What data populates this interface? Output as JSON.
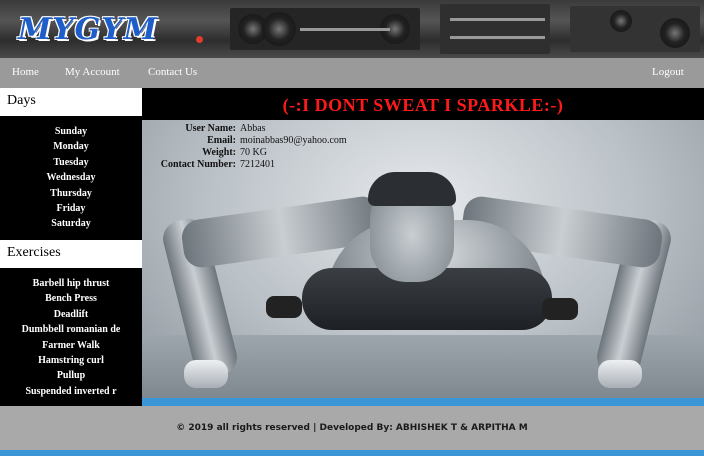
{
  "brand": {
    "logo_text": "MYGYM"
  },
  "nav": {
    "items": [
      {
        "label": "Home"
      },
      {
        "label": "My Account"
      },
      {
        "label": "Contact Us"
      }
    ],
    "logout_label": "Logout"
  },
  "sidebar": {
    "days_title": "Days",
    "days": [
      "Sunday",
      "Monday",
      "Tuesday",
      "Wednesday",
      "Thursday",
      "Friday",
      "Saturday"
    ],
    "exercises_title": "Exercises",
    "exercises": [
      "Barbell hip thrust",
      "Bench Press",
      "Deadlift",
      "Dumbbell romanian de",
      "Farmer Walk",
      "Hamstring curl",
      "Pullup",
      "Suspended inverted r"
    ]
  },
  "main": {
    "banner": "(-:I DONT SWEAT I SPARKLE:-)",
    "user": {
      "name_label": "User Name:",
      "name_value": "Abbas",
      "email_label": "Email:",
      "email_value": "moinabbas90@yahoo.com",
      "weight_label": "Weight:",
      "weight_value": "70 KG",
      "contact_label": "Contact Number:",
      "contact_value": "7212401"
    }
  },
  "footer": {
    "text": "© 2019 all rights reserved | Developed By: ABHISHEK T & ARPITHA M"
  },
  "colors": {
    "accent": "#3a96d6",
    "banner_text": "#ff1a1a",
    "logo": "#1f5ec9",
    "nav_bg": "#9a9a9a"
  }
}
